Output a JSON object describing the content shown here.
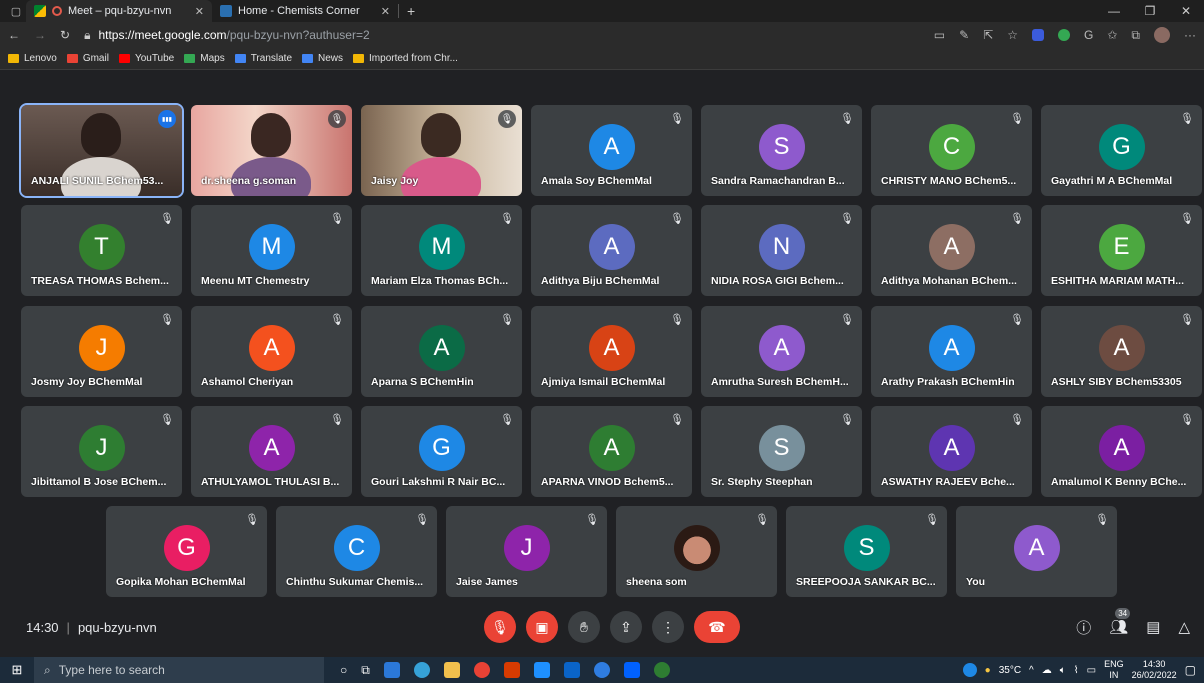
{
  "browser": {
    "tabs": [
      {
        "title": "Meet – pqu-bzyu-nvn",
        "active": true
      },
      {
        "title": "Home - Chemists Corner",
        "active": false
      }
    ],
    "url_host": "https://meet.google.com",
    "url_path": "/pqu-bzyu-nvn?authuser=2",
    "bookmarks": [
      {
        "label": "Lenovo",
        "color": "#f2b705"
      },
      {
        "label": "Gmail",
        "color": "#ea4335"
      },
      {
        "label": "YouTube",
        "color": "#ff0000"
      },
      {
        "label": "Maps",
        "color": "#34a853"
      },
      {
        "label": "Translate",
        "color": "#4285f4"
      },
      {
        "label": "News",
        "color": "#4285f4"
      },
      {
        "label": "Imported from Chr...",
        "color": "#f2b705"
      }
    ]
  },
  "participants": [
    {
      "name": "ANJALI SUNIL BChem53...",
      "video": true,
      "status": "speaking"
    },
    {
      "name": "dr.sheena g.soman",
      "video": true,
      "status": "muted"
    },
    {
      "name": "Jaisy Joy",
      "video": true,
      "status": "muted"
    },
    {
      "name": "Amala Soy BChemMal",
      "initial": "A",
      "color": "#1e88e5"
    },
    {
      "name": "Sandra Ramachandran B...",
      "initial": "S",
      "color": "#8e5acd"
    },
    {
      "name": "CHRISTY MANO BChem5...",
      "initial": "C",
      "color": "#4ca840"
    },
    {
      "name": "Gayathri M A BChemMal",
      "initial": "G",
      "color": "#00897b"
    },
    {
      "name": "TREASA THOMAS Bchem...",
      "initial": "T",
      "color": "#33802e"
    },
    {
      "name": "Meenu MT Chemestry",
      "initial": "M",
      "color": "#1e88e5"
    },
    {
      "name": "Mariam Elza Thomas BCh...",
      "initial": "M",
      "color": "#00897b"
    },
    {
      "name": "Adithya Biju BChemMal",
      "initial": "A",
      "color": "#5c6bc0"
    },
    {
      "name": "NIDIA ROSA GIGI Bchem...",
      "initial": "N",
      "color": "#5c6bc0"
    },
    {
      "name": "Adithya Mohanan BChem...",
      "initial": "A",
      "color": "#8d6e63"
    },
    {
      "name": "ESHITHA MARIAM MATH...",
      "initial": "E",
      "color": "#4ca840"
    },
    {
      "name": "Josmy Joy BChemMal",
      "initial": "J",
      "color": "#f57c00"
    },
    {
      "name": "Ashamol Cheriyan",
      "initial": "A",
      "color": "#f4511e"
    },
    {
      "name": "Aparna S BChemHin",
      "initial": "A",
      "color": "#0b6b46"
    },
    {
      "name": "Ajmiya Ismail BChemMal",
      "initial": "A",
      "color": "#d84315"
    },
    {
      "name": "Amrutha Suresh BChemH...",
      "initial": "A",
      "color": "#8e5acd"
    },
    {
      "name": "Arathy Prakash BChemHin",
      "initial": "A",
      "color": "#1e88e5"
    },
    {
      "name": "ASHLY SIBY BChem53305",
      "initial": "A",
      "color": "#6d4c41"
    },
    {
      "name": "Jibittamol B Jose BChem...",
      "initial": "J",
      "color": "#2e7d32"
    },
    {
      "name": "ATHULYAMOL THULASI B...",
      "initial": "A",
      "color": "#8e24aa"
    },
    {
      "name": "Gouri Lakshmi R Nair BC...",
      "initial": "G",
      "color": "#1e88e5"
    },
    {
      "name": "APARNA VINOD Bchem5...",
      "initial": "A",
      "color": "#2e7d32"
    },
    {
      "name": "Sr. Stephy Steephan",
      "initial": "S",
      "color": "#78909c"
    },
    {
      "name": "ASWATHY RAJEEV Bche...",
      "initial": "A",
      "color": "#5e35b1"
    },
    {
      "name": "Amalumol K Benny BChe...",
      "initial": "A",
      "color": "#7b1fa2"
    },
    {
      "name": "Gopika Mohan BChemMal",
      "initial": "G",
      "color": "#e91e63"
    },
    {
      "name": "Chinthu Sukumar Chemis...",
      "initial": "C",
      "color": "#1e88e5"
    },
    {
      "name": "Jaise James",
      "initial": "J",
      "color": "#8e24aa"
    },
    {
      "name": "sheena som",
      "photo": true
    },
    {
      "name": "SREEPOOJA SANKAR BC...",
      "initial": "S",
      "color": "#00897b"
    },
    {
      "name": "You",
      "initial": "A",
      "color": "#8e5acd"
    }
  ],
  "meeting": {
    "time": "14:30",
    "code": "pqu-bzyu-nvn",
    "participant_count": "34"
  },
  "taskbar": {
    "search_placeholder": "Type here to search",
    "temperature": "35°C",
    "lang": "ENG",
    "region": "IN",
    "clock_time": "14:30",
    "clock_date": "26/02/2022"
  }
}
